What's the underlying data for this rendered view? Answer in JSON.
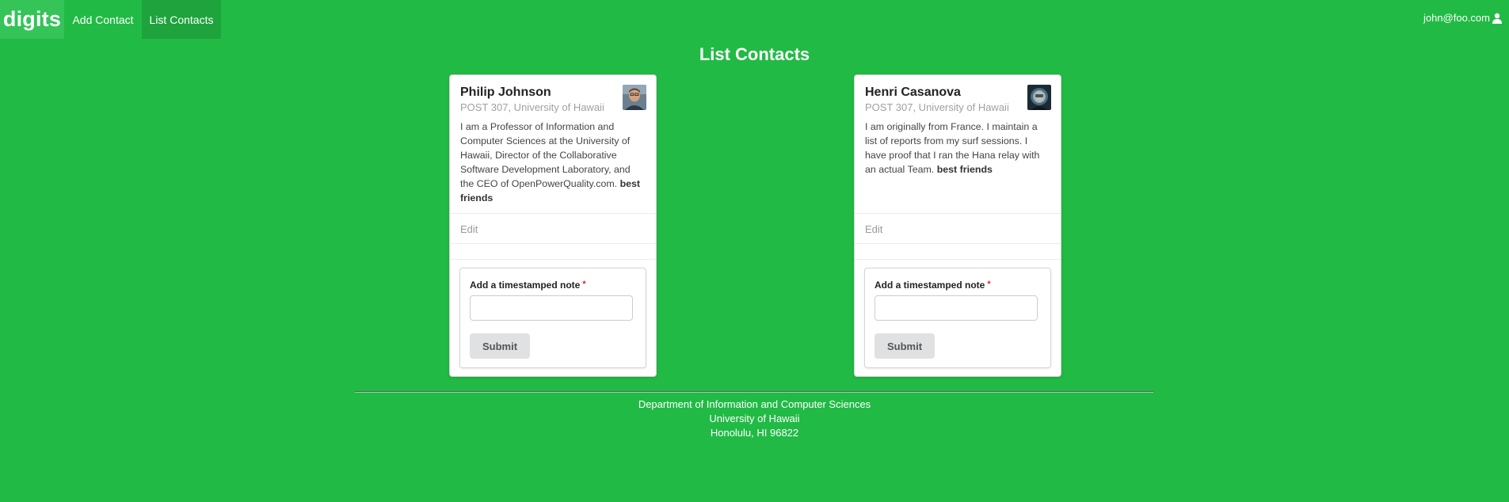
{
  "nav": {
    "brand": "digits",
    "add_contact": "Add Contact",
    "list_contacts": "List Contacts",
    "user": "john@foo.com",
    "user_icon": "user-icon"
  },
  "page": {
    "title": "List Contacts"
  },
  "contacts": [
    {
      "name": "Philip Johnson",
      "address": "POST 307, University of Hawaii",
      "description": "I am a Professor of Information and Computer Sciences at the University of Hawaii, Director of the Collaborative Software Development Laboratory, and the CEO of OpenPowerQuality.com.",
      "tag": "best friends",
      "edit_label": "Edit",
      "note_label": "Add a timestamped note",
      "note_value": "",
      "submit_label": "Submit"
    },
    {
      "name": "Henri Casanova",
      "address": "POST 307, University of Hawaii",
      "description": "I am originally from France. I maintain a list of reports from my surf sessions. I have proof that I ran the Hana relay with an actual Team.",
      "tag": "best friends",
      "edit_label": "Edit",
      "note_label": "Add a timestamped note",
      "note_value": "",
      "submit_label": "Submit"
    }
  ],
  "footer": {
    "line1": "Department of Information and Computer Sciences",
    "line2": "University of Hawaii",
    "line3": "Honolulu, HI 96822"
  },
  "colors": {
    "background": "#21ba45",
    "brand_bg": "#34c458",
    "active_nav_bg": "#1ea33d",
    "required": "#db2828"
  }
}
